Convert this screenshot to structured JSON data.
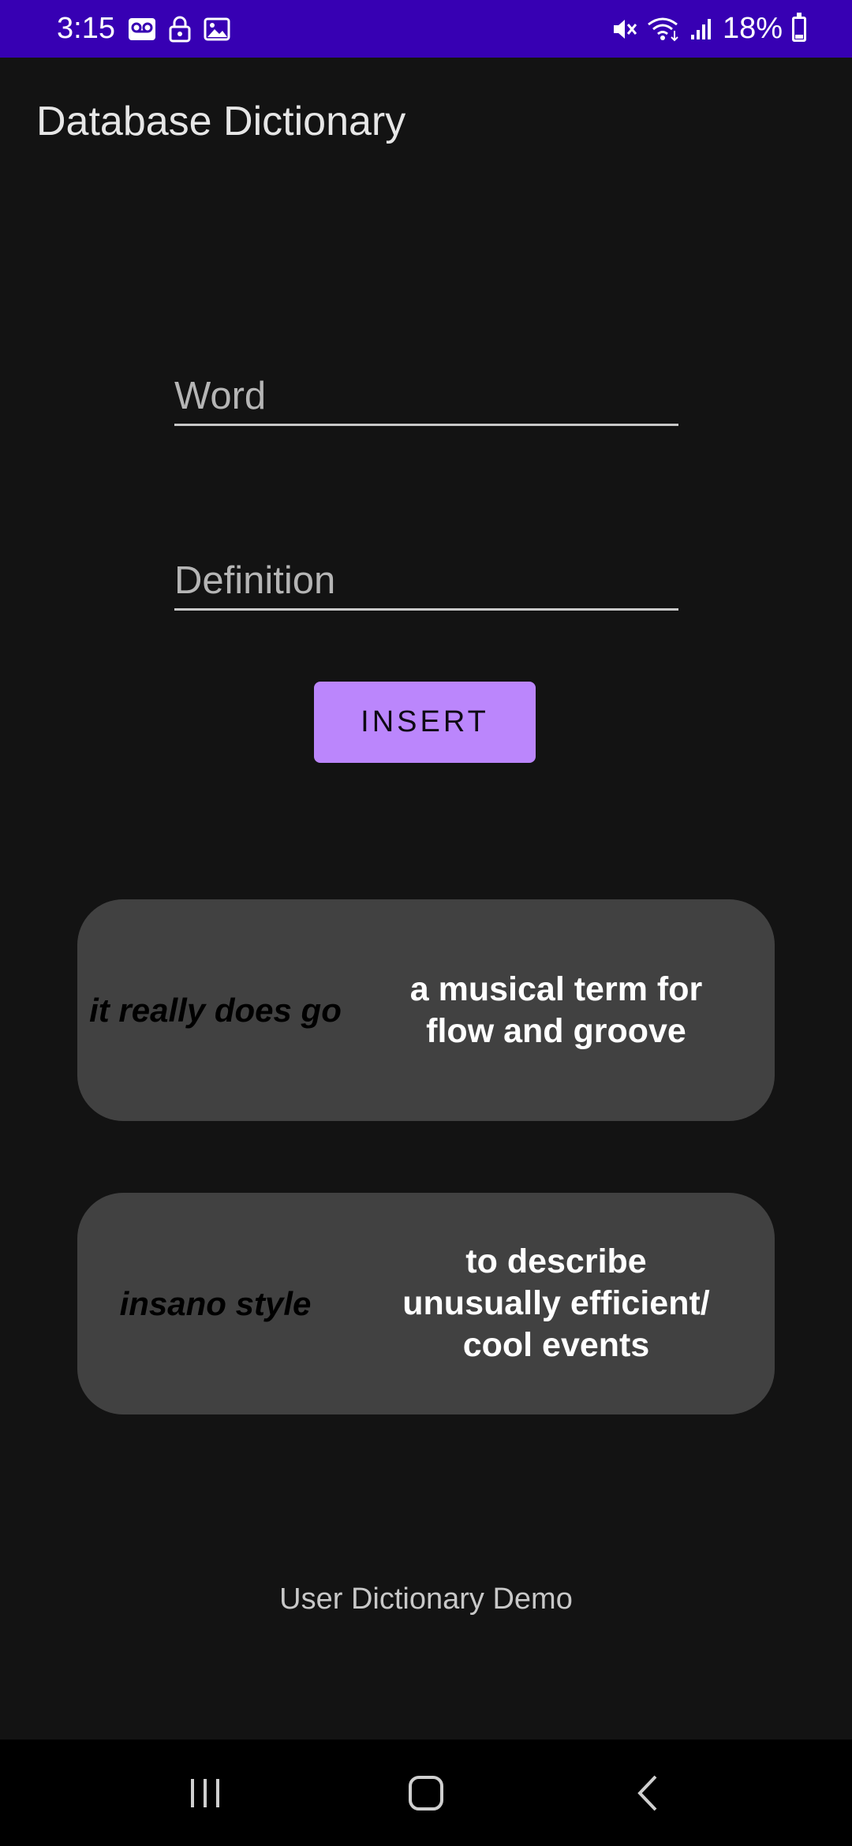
{
  "status_bar": {
    "time": "3:15",
    "battery": "18%",
    "left_icons": [
      "voicemail-icon",
      "lock-icon",
      "image-icon"
    ],
    "right_icons": [
      "mute-icon",
      "wifi-icon",
      "signal-icon",
      "battery-icon"
    ]
  },
  "app": {
    "title": "Database Dictionary"
  },
  "form": {
    "word_placeholder": "Word",
    "word_value": "",
    "definition_placeholder": "Definition",
    "definition_value": "",
    "insert_label": "INSERT"
  },
  "entries": [
    {
      "word": "it really does go",
      "definition": "a musical term for flow and groove"
    },
    {
      "word": "insano style",
      "definition": "to describe unusually efficient/ cool events"
    }
  ],
  "footer": {
    "text": "User Dictionary Demo"
  },
  "nav": {
    "recents": "recents-icon",
    "home": "home-icon",
    "back": "back-icon"
  },
  "colors": {
    "status_bar": "#3700B3",
    "accent": "#BB86FC",
    "background": "#131313",
    "card": "#414141"
  }
}
